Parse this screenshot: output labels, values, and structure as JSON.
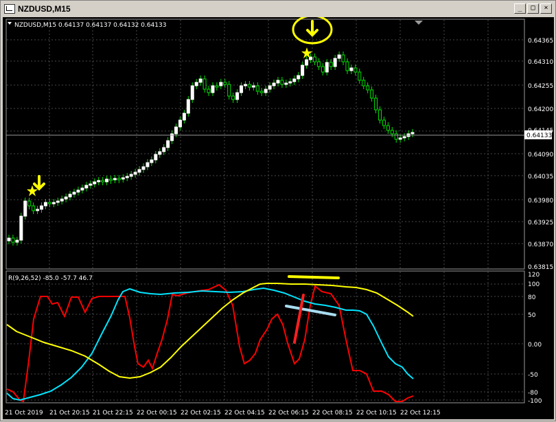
{
  "window": {
    "title": "NZDUSD,M15",
    "controls": [
      "_",
      "□",
      "×"
    ]
  },
  "price_panel": {
    "header": "NZDUSD,M15  0.64137 0.64137 0.64132 0.64133",
    "price_labels": [
      "0.64365",
      "0.64310",
      "0.64255",
      "0.64200",
      "0.64145",
      "0.64090",
      "0.64035",
      "0.63980",
      "0.63925",
      "0.63870",
      "0.63815"
    ],
    "current_price": "0.64133",
    "colors": {
      "bull": "#ffffff",
      "bear": "#00e000",
      "annotation": "#ffff00"
    }
  },
  "indicator_panel": {
    "header": "R(9,26,52) -85.0 -57.7 46.7",
    "level_labels": [
      "120",
      "100",
      "80",
      "50",
      "0.00",
      "-50",
      "-80",
      "-100"
    ],
    "colors": {
      "fast": "#ff0000",
      "mid": "#00e5ff",
      "slow": "#ffff00"
    }
  },
  "time_axis": {
    "labels": [
      "21 Oct 2019",
      "21 Oct 20:15",
      "21 Oct 22:15",
      "22 Oct 00:15",
      "22 Oct 02:15",
      "22 Oct 04:15",
      "22 Oct 06:15",
      "22 Oct 08:15",
      "22 Oct 10:15",
      "22 Oct 12:15"
    ]
  }
}
